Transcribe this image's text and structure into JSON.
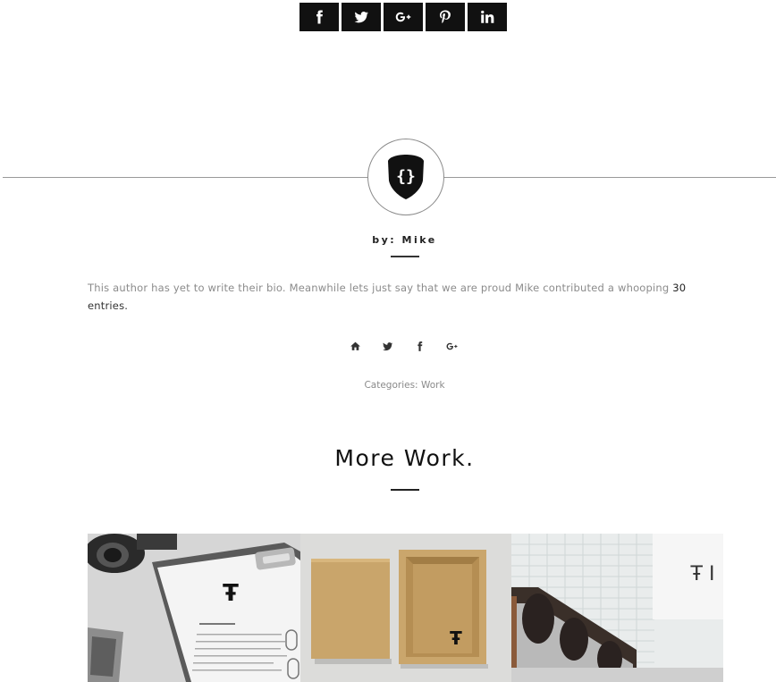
{
  "share": {
    "buttons": [
      {
        "name": "facebook",
        "label": "f"
      },
      {
        "name": "twitter",
        "label": ""
      },
      {
        "name": "google-plus",
        "label": "g+"
      },
      {
        "name": "pinterest",
        "label": "p"
      },
      {
        "name": "linkedin",
        "label": "in"
      }
    ]
  },
  "author": {
    "name_label": "by: Mike",
    "bio_text": "This author has yet to write their bio. Meanwhile lets just say that we are proud Mike contributed a whooping",
    "entry_count": "30",
    "entries_word": "entries.",
    "social_icons": [
      "home-icon",
      "twitter-icon",
      "facebook-icon",
      "google-plus-icon"
    ]
  },
  "categories": {
    "label": "Categories:",
    "value": "Work"
  },
  "more": {
    "title": "More Work."
  },
  "thumbnails": [
    {
      "name": "stationery-letter-clipboard"
    },
    {
      "name": "kraft-box-packaging"
    },
    {
      "name": "escalator-signage"
    }
  ],
  "colors": {
    "dark": "#111111",
    "text_muted": "#8b8b8b",
    "divider": "#9a9a9a"
  }
}
